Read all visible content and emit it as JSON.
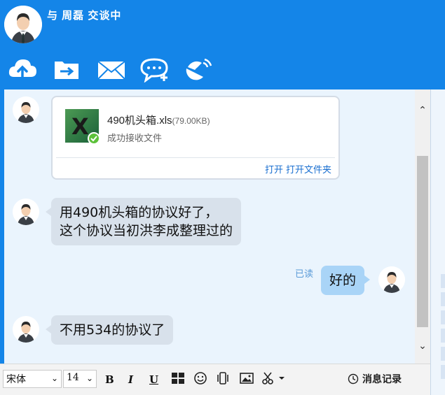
{
  "header": {
    "title": "与  周磊  交谈中",
    "tools": [
      "upload-icon",
      "folder-send-icon",
      "mail-icon",
      "chat-add-icon",
      "satellite-icon"
    ]
  },
  "messages": {
    "file": {
      "name": "490机头箱.xls",
      "size": "(79.00KB)",
      "status": "成功接收文件",
      "open": "打开",
      "open_folder": "打开文件夹"
    },
    "msg1_line1": "用490机头箱的协议好了，",
    "msg1_line2": "这个协议当初洪李成整理过的",
    "msg2": "好的",
    "read": "已读",
    "msg3": "不用534的协议了"
  },
  "input_bar": {
    "font": "宋体",
    "size": "14",
    "bold": "B",
    "italic": "I",
    "underline": "U",
    "history": "消息记录"
  },
  "colors": {
    "brand": "#1485e8",
    "chat_bg": "#eaf4fd",
    "bubble_other": "#d8e1eb",
    "bubble_me": "#a9d4f7",
    "excel_green": "#217346"
  }
}
